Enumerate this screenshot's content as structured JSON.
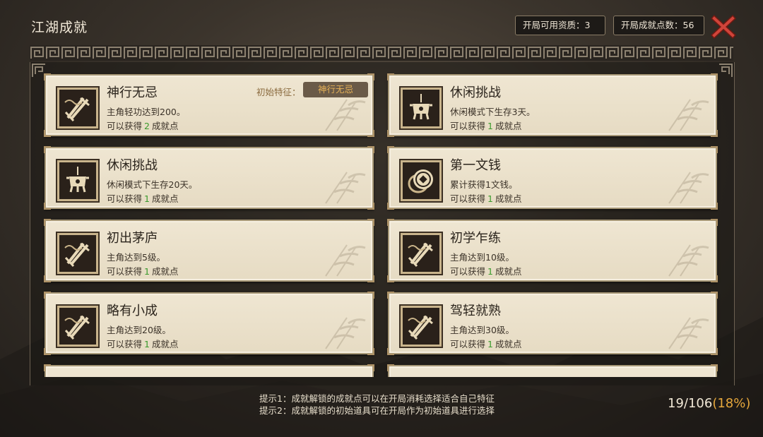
{
  "window": {
    "title": "江湖成就"
  },
  "stats": [
    {
      "label": "开局可用资质：3"
    },
    {
      "label": "开局成就点数：56"
    }
  ],
  "close_icon": "close-x-icon",
  "colors": {
    "accent": "#e7a83c",
    "reward_green": "#3a9a2c",
    "trait_chip_text": "#e5b158"
  },
  "achievements": [
    {
      "name": "神行无忌",
      "desc": "主角轻功达到200。",
      "reward_prefix": "可以获得",
      "reward_points": "2",
      "reward_suffix": "成就点",
      "icon": "crossed-swords-icon",
      "trait_label": "初始特征：",
      "trait_value": "神行无忌"
    },
    {
      "name": "休闲挑战",
      "desc": "休闲模式下生存3天。",
      "reward_prefix": "可以获得",
      "reward_points": "1",
      "reward_suffix": "成就点",
      "icon": "incense-burner-icon"
    },
    {
      "name": "休闲挑战",
      "desc": "休闲模式下生存20天。",
      "reward_prefix": "可以获得",
      "reward_points": "1",
      "reward_suffix": "成就点",
      "icon": "incense-burner-icon"
    },
    {
      "name": "第一文钱",
      "desc": "累计获得1文钱。",
      "reward_prefix": "可以获得",
      "reward_points": "1",
      "reward_suffix": "成就点",
      "icon": "coin-icon"
    },
    {
      "name": "初出茅庐",
      "desc": "主角达到5级。",
      "reward_prefix": "可以获得",
      "reward_points": "1",
      "reward_suffix": "成就点",
      "icon": "crossed-swords-icon"
    },
    {
      "name": "初学乍练",
      "desc": "主角达到10级。",
      "reward_prefix": "可以获得",
      "reward_points": "1",
      "reward_suffix": "成就点",
      "icon": "crossed-swords-icon"
    },
    {
      "name": "略有小成",
      "desc": "主角达到20级。",
      "reward_prefix": "可以获得",
      "reward_points": "1",
      "reward_suffix": "成就点",
      "icon": "crossed-swords-icon"
    },
    {
      "name": "驾轻就熟",
      "desc": "主角达到30级。",
      "reward_prefix": "可以获得",
      "reward_points": "1",
      "reward_suffix": "成就点",
      "icon": "crossed-swords-icon"
    }
  ],
  "hints": [
    "提示1：成就解锁的成就点可以在开局消耗选择适合自己特征",
    "提示2：成就解锁的初始道具可在开局作为初始道具进行选择"
  ],
  "progress": {
    "count": "19/106",
    "percent": "(18%)"
  }
}
